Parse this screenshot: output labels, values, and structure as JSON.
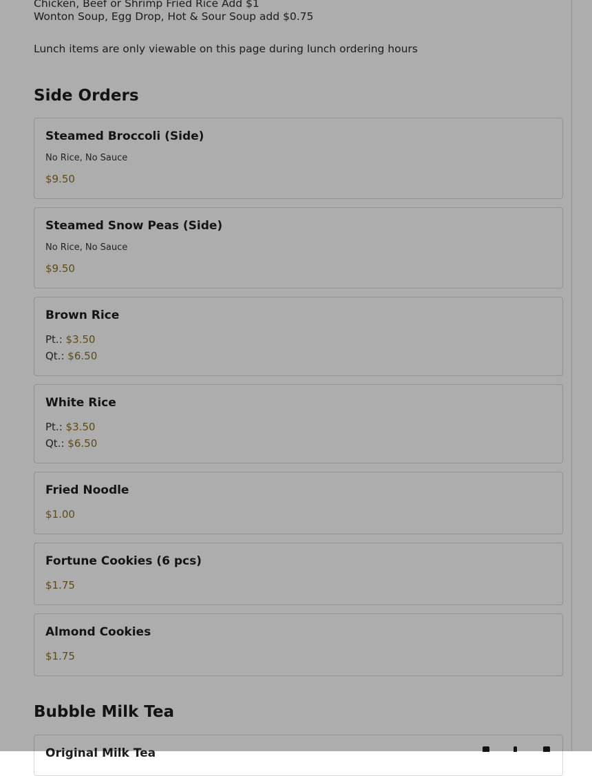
{
  "notes": {
    "fried_rice_addon": "Chicken, Beef or Shrimp Fried Rice Add $1",
    "soup_addon": "Wonton Soup, Egg Drop, Hot & Sour Soup add $0.75",
    "lunch_notice": "Lunch items are only viewable on this page during lunch ordering hours"
  },
  "sections": {
    "side_orders": {
      "title": "Side Orders",
      "items": [
        {
          "name": "Steamed Broccoli (Side)",
          "description": "No Rice, No Sauce",
          "price": "$9.50"
        },
        {
          "name": "Steamed Snow Peas (Side)",
          "description": "No Rice, No Sauce",
          "price": "$9.50"
        },
        {
          "name": "Brown Rice",
          "sizes": [
            {
              "label": "Pt.:",
              "price": "$3.50"
            },
            {
              "label": "Qt.:",
              "price": "$6.50"
            }
          ]
        },
        {
          "name": "White Rice",
          "sizes": [
            {
              "label": "Pt.:",
              "price": "$3.50"
            },
            {
              "label": "Qt.:",
              "price": "$6.50"
            }
          ]
        },
        {
          "name": "Fried Noodle",
          "price": "$1.00"
        },
        {
          "name": "Fortune Cookies (6 pcs)",
          "price": "$1.75"
        },
        {
          "name": "Almond Cookies",
          "price": "$1.75"
        }
      ]
    },
    "bubble_milk_tea": {
      "title": "Bubble Milk Tea",
      "items": [
        {
          "name": "Original Milk Tea"
        }
      ]
    }
  },
  "colors": {
    "price": "#8a6d1f",
    "border": "#d6d6d6",
    "overlay": "rgba(0,0,0,0.32)"
  }
}
